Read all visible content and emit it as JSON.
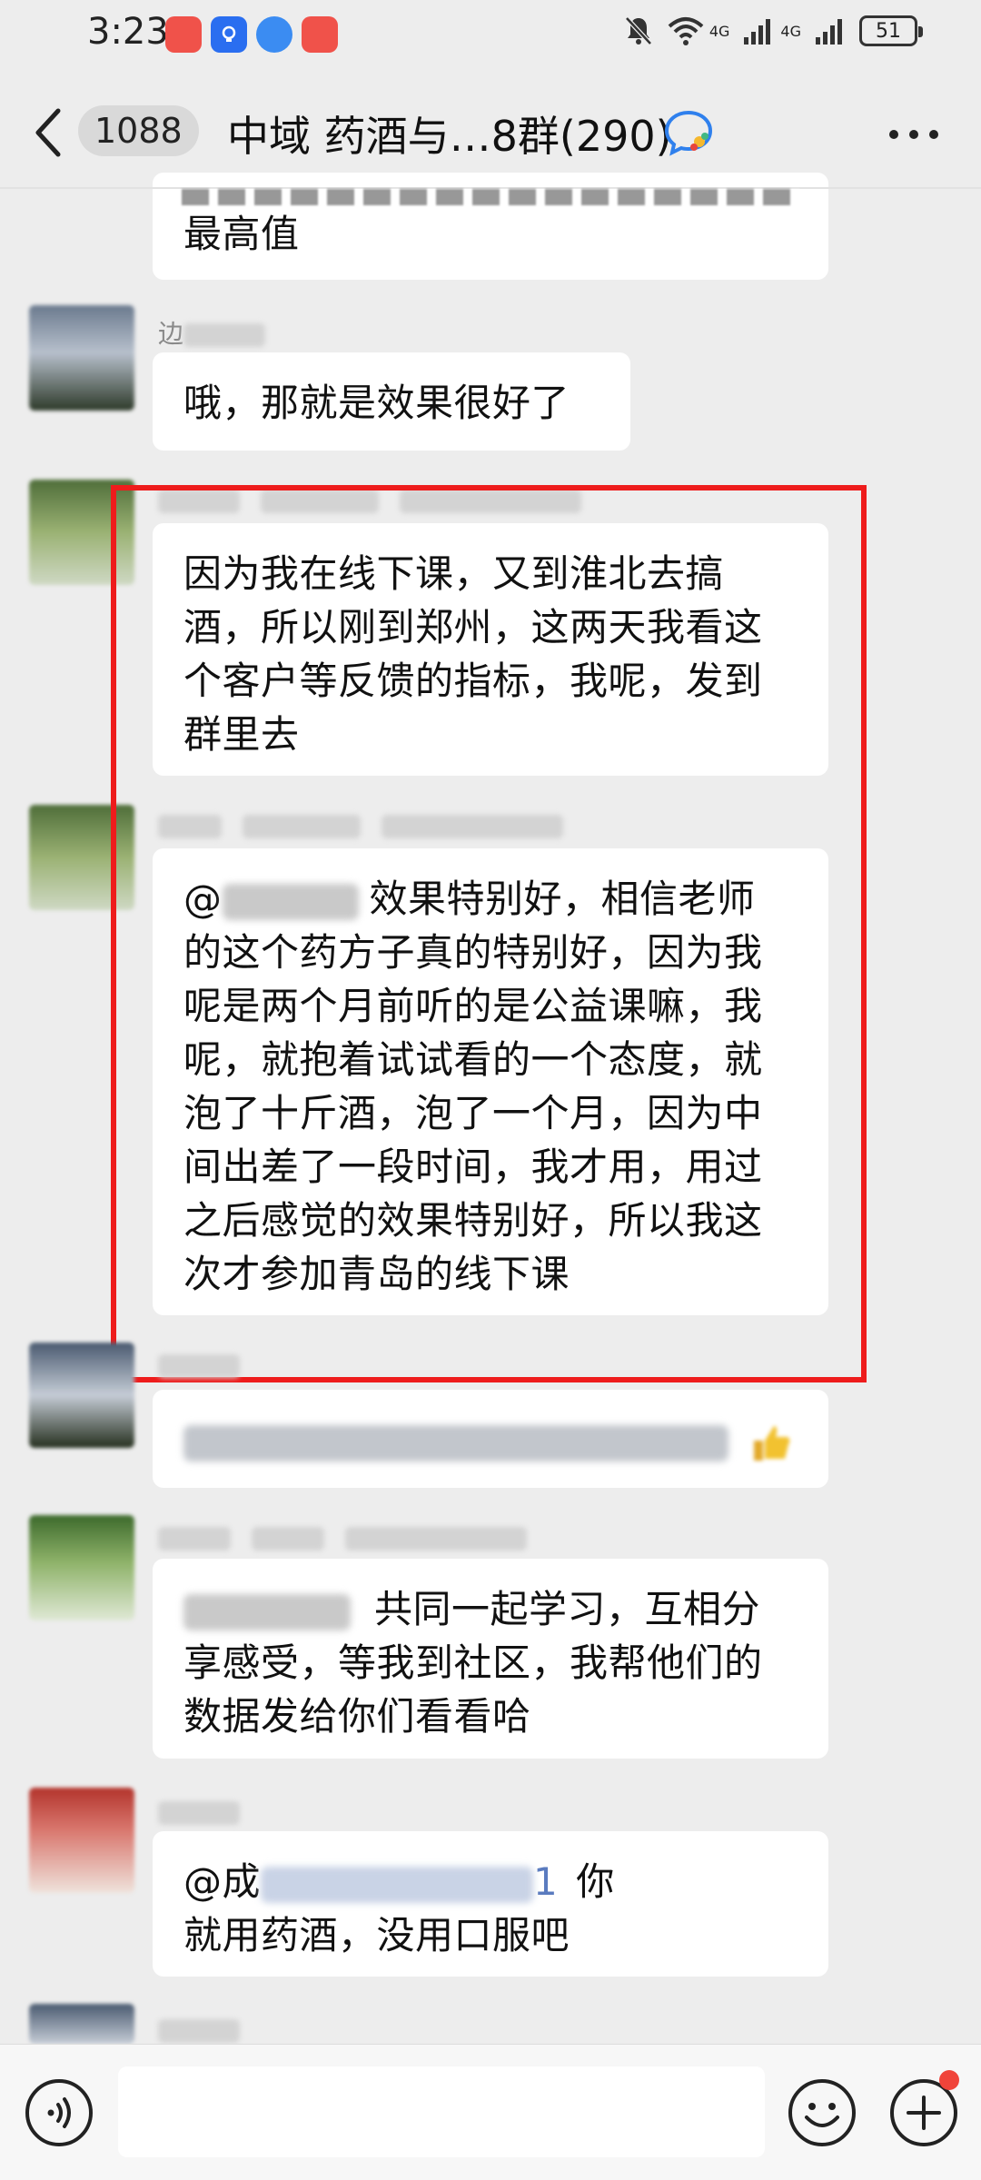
{
  "status_bar": {
    "time": "3:23",
    "network_1": "4G",
    "network_2": "4G",
    "battery": "51"
  },
  "header": {
    "unread_count": "1088",
    "title": "中域 药酒与…8群(290)"
  },
  "messages": [
    {
      "sender": "",
      "lines": [
        "最高值"
      ]
    },
    {
      "sender": "边",
      "lines": [
        "哦，那就是效果很好了"
      ]
    },
    {
      "sender": "",
      "lines": [
        "因为我在线下课，又到淮北去搞",
        "酒，所以刚到郑州，这两天我看这",
        "个客户等反馈的指标，我呢，发到",
        "群里去"
      ]
    },
    {
      "sender": "",
      "mention_prefix": "@",
      "lines": [
        "效果特别好，相信老师",
        "的这个药方子真的特别好，因为我",
        "呢是两个月前听的是公益课嘛，我",
        "呢，就抱着试试看的一个态度，就",
        "泡了十斤酒，泡了一个月，因为中",
        "间出差了一段时间，我才用，用过",
        "之后感觉的效果特别好，所以我这",
        "次才参加青岛的线下课"
      ]
    },
    {
      "sender": "",
      "lines": [
        ""
      ]
    },
    {
      "sender": "",
      "lines": [
        "共同一起学习，互相分",
        "享感受，等我到社区，我帮他们的",
        "数据发给你们看看哈"
      ]
    },
    {
      "sender": "",
      "mention_prefix": "@成",
      "mention_suffix": "1",
      "lines": [
        "你",
        "就用药酒，没用口服吧"
      ]
    }
  ],
  "input": {
    "placeholder": ""
  },
  "colors": {
    "background": "#ededed",
    "bubble": "#ffffff",
    "highlight_frame": "#ee1c1c",
    "badge": "#f0443a"
  }
}
